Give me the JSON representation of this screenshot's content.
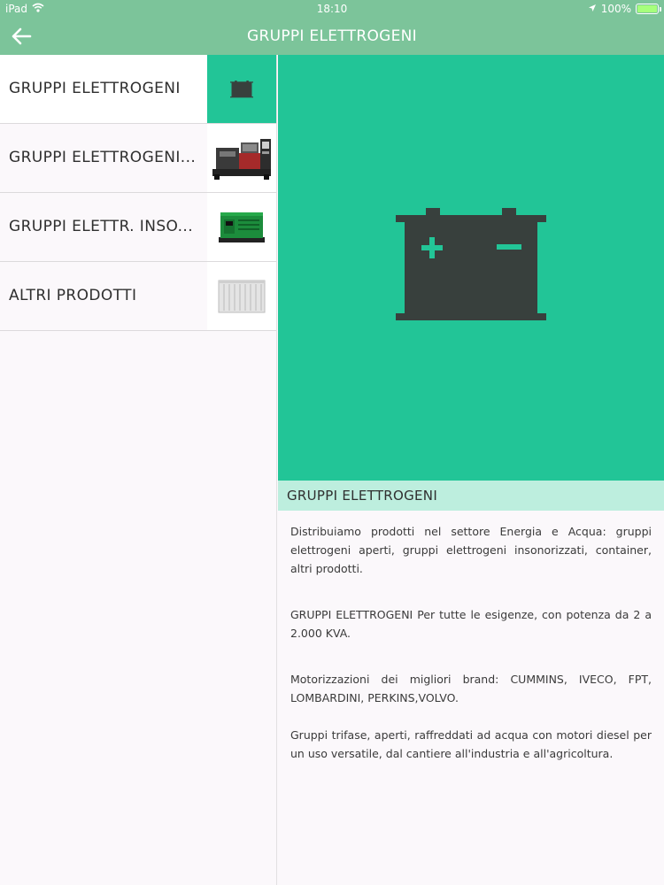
{
  "status_bar": {
    "device": "iPad",
    "time": "18:10",
    "battery": "100%"
  },
  "nav": {
    "title": "GRUPPI ELETTROGENI",
    "back_icon": "arrow-left-icon"
  },
  "sidebar": {
    "items": [
      {
        "label": "GRUPPI ELETTROGENI",
        "icon": "battery-icon",
        "active": true
      },
      {
        "label": "GRUPPI ELETTROGENI...",
        "icon": "open-generator-image"
      },
      {
        "label": "GRUPPI ELETTR. INSO...",
        "icon": "silent-generator-image"
      },
      {
        "label": "ALTRI PRODOTTI",
        "icon": "container-image"
      }
    ]
  },
  "detail": {
    "hero_icon": "battery-icon",
    "title": "GRUPPI ELETTROGENI",
    "paragraphs": [
      "Distribuiamo prodotti nel settore Energia e Acqua: gruppi elettrogeni aperti, gruppi elettrogeni insonorizzati, container, altri prodotti.",
      "GRUPPI ELETTROGENI Per tutte le esigenze, con potenza da 2 a 2.000 KVA.",
      "Motorizzazioni dei migliori brand: CUMMINS, IVECO, FPT, LOMBARDINI, PERKINS,VOLVO.",
      "Gruppi trifase, aperti, raffreddati ad acqua con motori diesel per un uso versatile, dal cantiere all'industria e all'agricoltura."
    ]
  },
  "colors": {
    "nav_bg": "#7cc49a",
    "accent": "#22c597",
    "header_bg": "#bdeede",
    "icon_dark": "#38403d"
  }
}
